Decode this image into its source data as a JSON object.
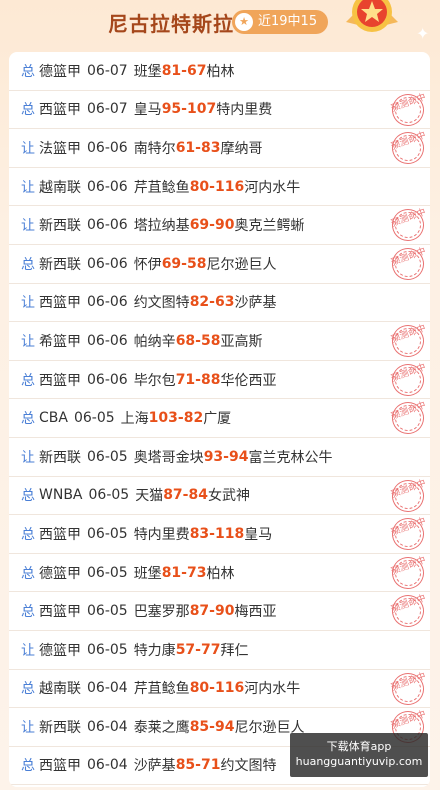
{
  "header": {
    "title": "尼古拉特斯拉",
    "record": "近19中15",
    "star_icon": "star-icon",
    "medal_icon": "medal-icon"
  },
  "rows": [
    {
      "type": "总",
      "league": "德篮甲",
      "date": "06-07",
      "home": "班堡",
      "home_score": "81",
      "sep": " - ",
      "away_score": "67",
      "away": "柏林",
      "hit": false
    },
    {
      "type": "总",
      "league": "西篮甲",
      "date": "06-07",
      "home": "皇马",
      "home_score": "95",
      "sep": " - ",
      "away_score": "107",
      "away": "特内里费",
      "hit": true
    },
    {
      "type": "让",
      "league": "法篮甲",
      "date": "06-06",
      "home": "南特尔",
      "home_score": "61",
      "sep": " - ",
      "away_score": "83",
      "away": "摩纳哥",
      "hit": true
    },
    {
      "type": "让",
      "league": "越南联",
      "date": "06-06",
      "home": "芹苴鲶鱼",
      "home_score": "80",
      "sep": " - ",
      "away_score": "116",
      "away": "河内水牛",
      "hit": false
    },
    {
      "type": "让",
      "league": "新西联",
      "date": "06-06",
      "home": "塔拉纳基",
      "home_score": "69",
      "sep": " - ",
      "away_score": "90",
      "away": "奥克兰鳄蜥",
      "hit": true
    },
    {
      "type": "总",
      "league": "新西联",
      "date": "06-06",
      "home": "怀伊",
      "home_score": "69",
      "sep": " - ",
      "away_score": "58",
      "away": "尼尔逊巨人",
      "hit": true
    },
    {
      "type": "让",
      "league": "西篮甲",
      "date": "06-06",
      "home": "约文图特",
      "home_score": "82",
      "sep": " - ",
      "away_score": "63",
      "away": "沙萨基",
      "hit": false
    },
    {
      "type": "让",
      "league": "希篮甲",
      "date": "06-06",
      "home": "帕纳辛",
      "home_score": "68",
      "sep": " - ",
      "away_score": "58",
      "away": "亚高斯",
      "hit": true
    },
    {
      "type": "总",
      "league": "西篮甲",
      "date": "06-06",
      "home": "毕尔包",
      "home_score": "71",
      "sep": " - ",
      "away_score": "88",
      "away": "华伦西亚",
      "hit": true
    },
    {
      "type": "总",
      "league": "CBA",
      "date": "06-05",
      "home": "上海",
      "home_score": "103",
      "sep": " - ",
      "away_score": "82",
      "away": "广厦",
      "hit": true
    },
    {
      "type": "让",
      "league": "新西联",
      "date": "06-05",
      "home": "奥塔哥金块",
      "home_score": "93",
      "sep": " - ",
      "away_score": "94",
      "away": "富兰克林公牛",
      "hit": false
    },
    {
      "type": "总",
      "league": "WNBA",
      "date": "06-05",
      "home": "天猫",
      "home_score": "87",
      "sep": " - ",
      "away_score": "84",
      "away": "女武神",
      "hit": true
    },
    {
      "type": "总",
      "league": "西篮甲",
      "date": "06-05",
      "home": "特内里费",
      "home_score": "83",
      "sep": " - ",
      "away_score": "118",
      "away": "皇马",
      "hit": true
    },
    {
      "type": "总",
      "league": "德篮甲",
      "date": "06-05",
      "home": "班堡",
      "home_score": "81",
      "sep": " - ",
      "away_score": "73",
      "away": "柏林",
      "hit": true
    },
    {
      "type": "总",
      "league": "西篮甲",
      "date": "06-05",
      "home": "巴塞罗那",
      "home_score": "87",
      "sep": " - ",
      "away_score": "90",
      "away": "梅西亚",
      "hit": true
    },
    {
      "type": "让",
      "league": "德篮甲",
      "date": "06-05",
      "home": "特力康",
      "home_score": "57",
      "sep": " - ",
      "away_score": "77",
      "away": "拜仁",
      "hit": false
    },
    {
      "type": "总",
      "league": "越南联",
      "date": "06-04",
      "home": "芹苴鲶鱼",
      "home_score": "80",
      "sep": " - ",
      "away_score": "116",
      "away": "河内水牛",
      "hit": true
    },
    {
      "type": "让",
      "league": "新西联",
      "date": "06-04",
      "home": "泰莱之鹰",
      "home_score": "85",
      "sep": " - ",
      "away_score": "94",
      "away": "尼尔逊巨人",
      "hit": true
    },
    {
      "type": "总",
      "league": "西篮甲",
      "date": "06-04",
      "home": "沙萨基",
      "home_score": "85",
      "sep": " - ",
      "away_score": "71",
      "away": "约文图特",
      "hit": false
    }
  ],
  "stamp_text": "预测命中",
  "watermark": {
    "line1": "下载体育app",
    "line2": "huangguantiyuvip.com"
  },
  "colors": {
    "accent": "#e8501a",
    "type_blue": "#4a7fd6",
    "stamp_red": "#e65a5a",
    "title_brown": "#a5471b"
  }
}
